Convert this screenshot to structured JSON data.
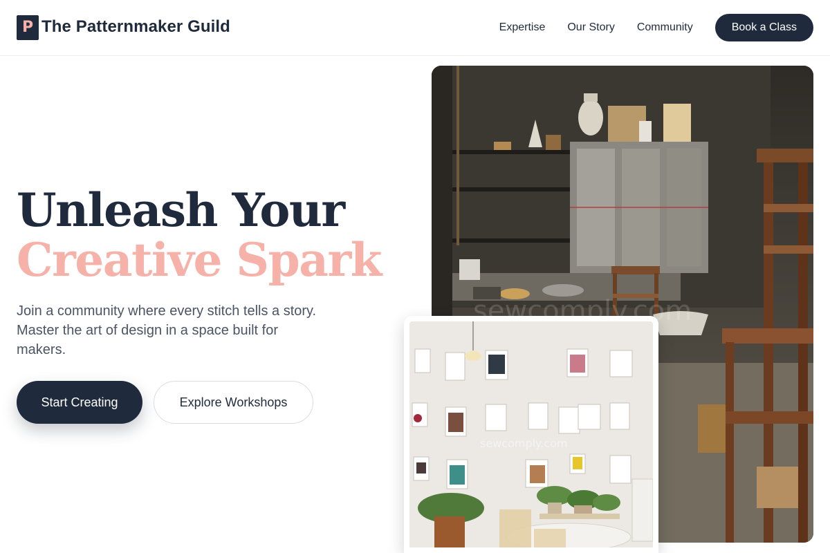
{
  "brand": {
    "logo_letter": "P",
    "name": "The Patternmaker Guild"
  },
  "nav": {
    "links": [
      "Expertise",
      "Our Story",
      "Community"
    ],
    "cta": "Book a Class"
  },
  "hero": {
    "title_line1": "Unleash Your",
    "title_line2": "Creative Spark",
    "subtitle": "Join a community where every stitch tells a story. Master the art of design in a space built for makers.",
    "primary_button": "Start Creating",
    "secondary_button": "Explore Workshops"
  },
  "images": {
    "main_watermark": "sewcomply.com",
    "inset_watermark": "sewcomply.com"
  },
  "colors": {
    "navy": "#1f2a3d",
    "accent_pink": "#f6b1a8",
    "body_text": "#4a5464"
  }
}
